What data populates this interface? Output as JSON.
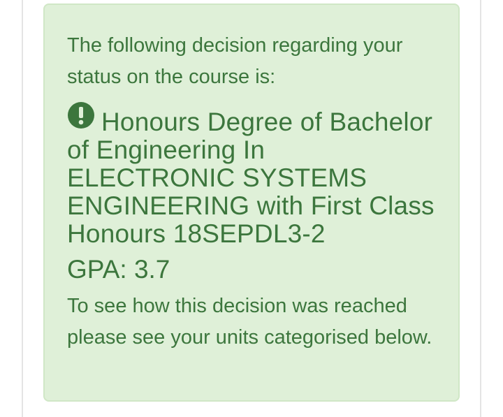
{
  "decision": {
    "intro_text": "The following decision regarding your status on the course is:",
    "icon": "exclamation-circle-icon",
    "award_text": "Honours Degree of Bachelor of Engineering In ELECTRONIC SYSTEMS ENGINEERING with First Class Honours 18SEPDL3-2",
    "gpa_label": "GPA:",
    "gpa_value": "3.7",
    "explanation_text": "To see how this decision was reached please see your units categorised below."
  },
  "colors": {
    "panel_background": "#dff0d8",
    "panel_border": "#d0e7c6",
    "text": "#3c763d",
    "page_border": "#e4e4e4"
  }
}
